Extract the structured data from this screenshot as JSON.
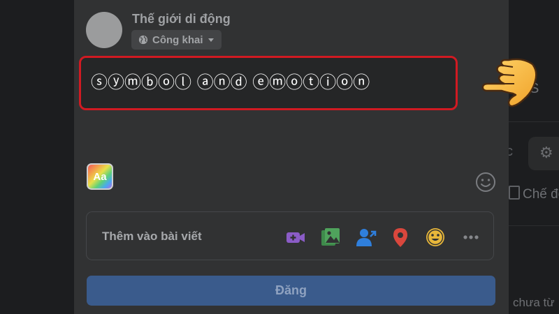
{
  "composer": {
    "user_name": "Thế giới di động",
    "privacy_label": "Công khai",
    "post_text": "ⓢⓨⓜⓑⓞⓛ ⓐⓝⓓ ⓔⓜⓞⓣⓘⓞⓝ",
    "text_style_button_label": "Aa",
    "add_to_post_label": "Thêm vào bài viết",
    "add_to_post_icons": [
      "video-camera-icon",
      "photo-gallery-icon",
      "tag-people-icon",
      "location-pin-icon",
      "feeling-emoji-icon",
      "more-dots-icon"
    ],
    "submit_label": "Đăng"
  },
  "background": {
    "mode_text": "Chế độ",
    "footer_text": "chưa từ",
    "top_text": "S",
    "side_text": "c"
  },
  "colors": {
    "highlight_border": "#d11a22",
    "submit_button": "#3a5b8c",
    "video_icon": "#8b5cc7",
    "photo_icon": "#4fa35c",
    "tag_icon": "#2f7fdc",
    "location_icon": "#d9473d",
    "feeling_icon": "#e8b73a"
  }
}
